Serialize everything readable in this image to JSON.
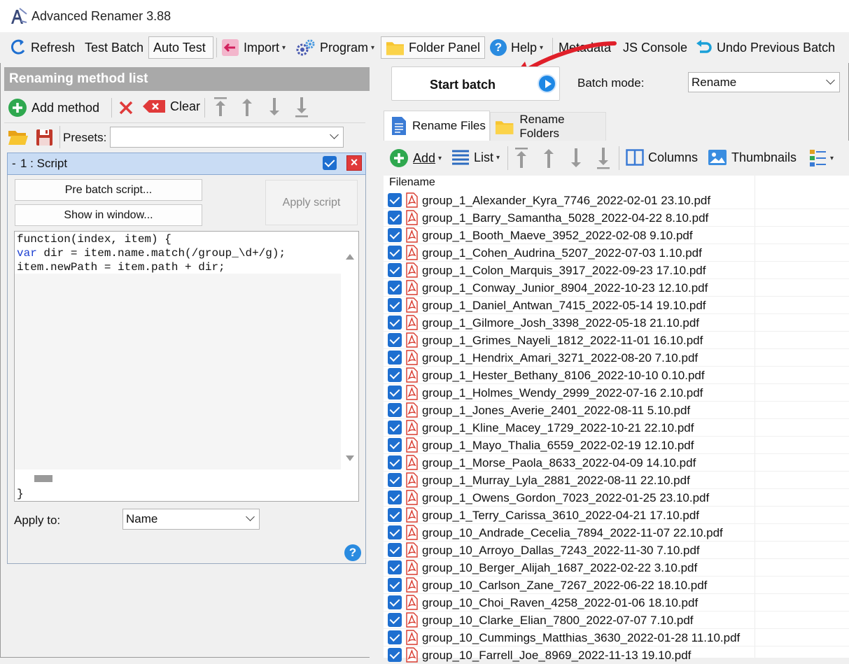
{
  "window": {
    "title": "Advanced Renamer 3.88"
  },
  "toolbar": {
    "refresh": "Refresh",
    "test_batch": "Test Batch",
    "auto_test": "Auto Test",
    "import": "Import",
    "program": "Program",
    "folder_panel": "Folder Panel",
    "help": "Help",
    "metadata": "Metadata",
    "js_console": "JS Console",
    "undo": "Undo Previous Batch"
  },
  "left": {
    "header": "Renaming method list",
    "add_method": "Add method",
    "clear": "Clear",
    "presets_label": "Presets:",
    "presets_value": "",
    "method_title": "1 : Script",
    "pre_batch": "Pre batch script...",
    "show_in_window": "Show in window...",
    "apply_script": "Apply script",
    "code": {
      "line1": "function(index, item) {",
      "line2_kw": "var",
      "line2_rest": " dir = item.name.match(/group_\\d+/g);",
      "line3": "item.newPath = item.path + dir;",
      "closing": "}"
    },
    "apply_to_label": "Apply to:",
    "apply_to_value": "Name"
  },
  "right": {
    "start_batch": "Start batch",
    "batch_mode_label": "Batch mode:",
    "batch_mode_value": "Rename",
    "tabs": [
      "Rename Files",
      "Rename Folders"
    ],
    "file_toolbar": {
      "add": "Add",
      "list": "List",
      "columns": "Columns",
      "thumbnails": "Thumbnails"
    },
    "column_header": "Filename",
    "files": [
      "group_1_Alexander_Kyra_7746_2022-02-01 23.10.pdf",
      "group_1_Barry_Samantha_5028_2022-04-22 8.10.pdf",
      "group_1_Booth_Maeve_3952_2022-02-08 9.10.pdf",
      "group_1_Cohen_Audrina_5207_2022-07-03 1.10.pdf",
      "group_1_Colon_Marquis_3917_2022-09-23 17.10.pdf",
      "group_1_Conway_Junior_8904_2022-10-23 12.10.pdf",
      "group_1_Daniel_Antwan_7415_2022-05-14 19.10.pdf",
      "group_1_Gilmore_Josh_3398_2022-05-18 21.10.pdf",
      "group_1_Grimes_Nayeli_1812_2022-11-01 16.10.pdf",
      "group_1_Hendrix_Amari_3271_2022-08-20 7.10.pdf",
      "group_1_Hester_Bethany_8106_2022-10-10 0.10.pdf",
      "group_1_Holmes_Wendy_2999_2022-07-16 2.10.pdf",
      "group_1_Jones_Averie_2401_2022-08-11 5.10.pdf",
      "group_1_Kline_Macey_1729_2022-10-21 22.10.pdf",
      "group_1_Mayo_Thalia_6559_2022-02-19 12.10.pdf",
      "group_1_Morse_Paola_8633_2022-04-09 14.10.pdf",
      "group_1_Murray_Lyla_2881_2022-08-11 22.10.pdf",
      "group_1_Owens_Gordon_7023_2022-01-25 23.10.pdf",
      "group_1_Terry_Carissa_3610_2022-04-21 17.10.pdf",
      "group_10_Andrade_Cecelia_7894_2022-11-07 22.10.pdf",
      "group_10_Arroyo_Dallas_7243_2022-11-30 7.10.pdf",
      "group_10_Berger_Alijah_1687_2022-02-22 3.10.pdf",
      "group_10_Carlson_Zane_7267_2022-06-22 18.10.pdf",
      "group_10_Choi_Raven_4258_2022-01-06 18.10.pdf",
      "group_10_Clarke_Elian_7800_2022-07-07 7.10.pdf",
      "group_10_Cummings_Matthias_3630_2022-01-28 11.10.pdf",
      "group_10_Farrell_Joe_8969_2022-11-13 19.10.pdf"
    ]
  },
  "colors": {
    "accent_blue": "#1e6fd0",
    "annotation_red": "#e0202a",
    "header_gray": "#a9a9a9",
    "method_head": "#c9dcf4"
  }
}
